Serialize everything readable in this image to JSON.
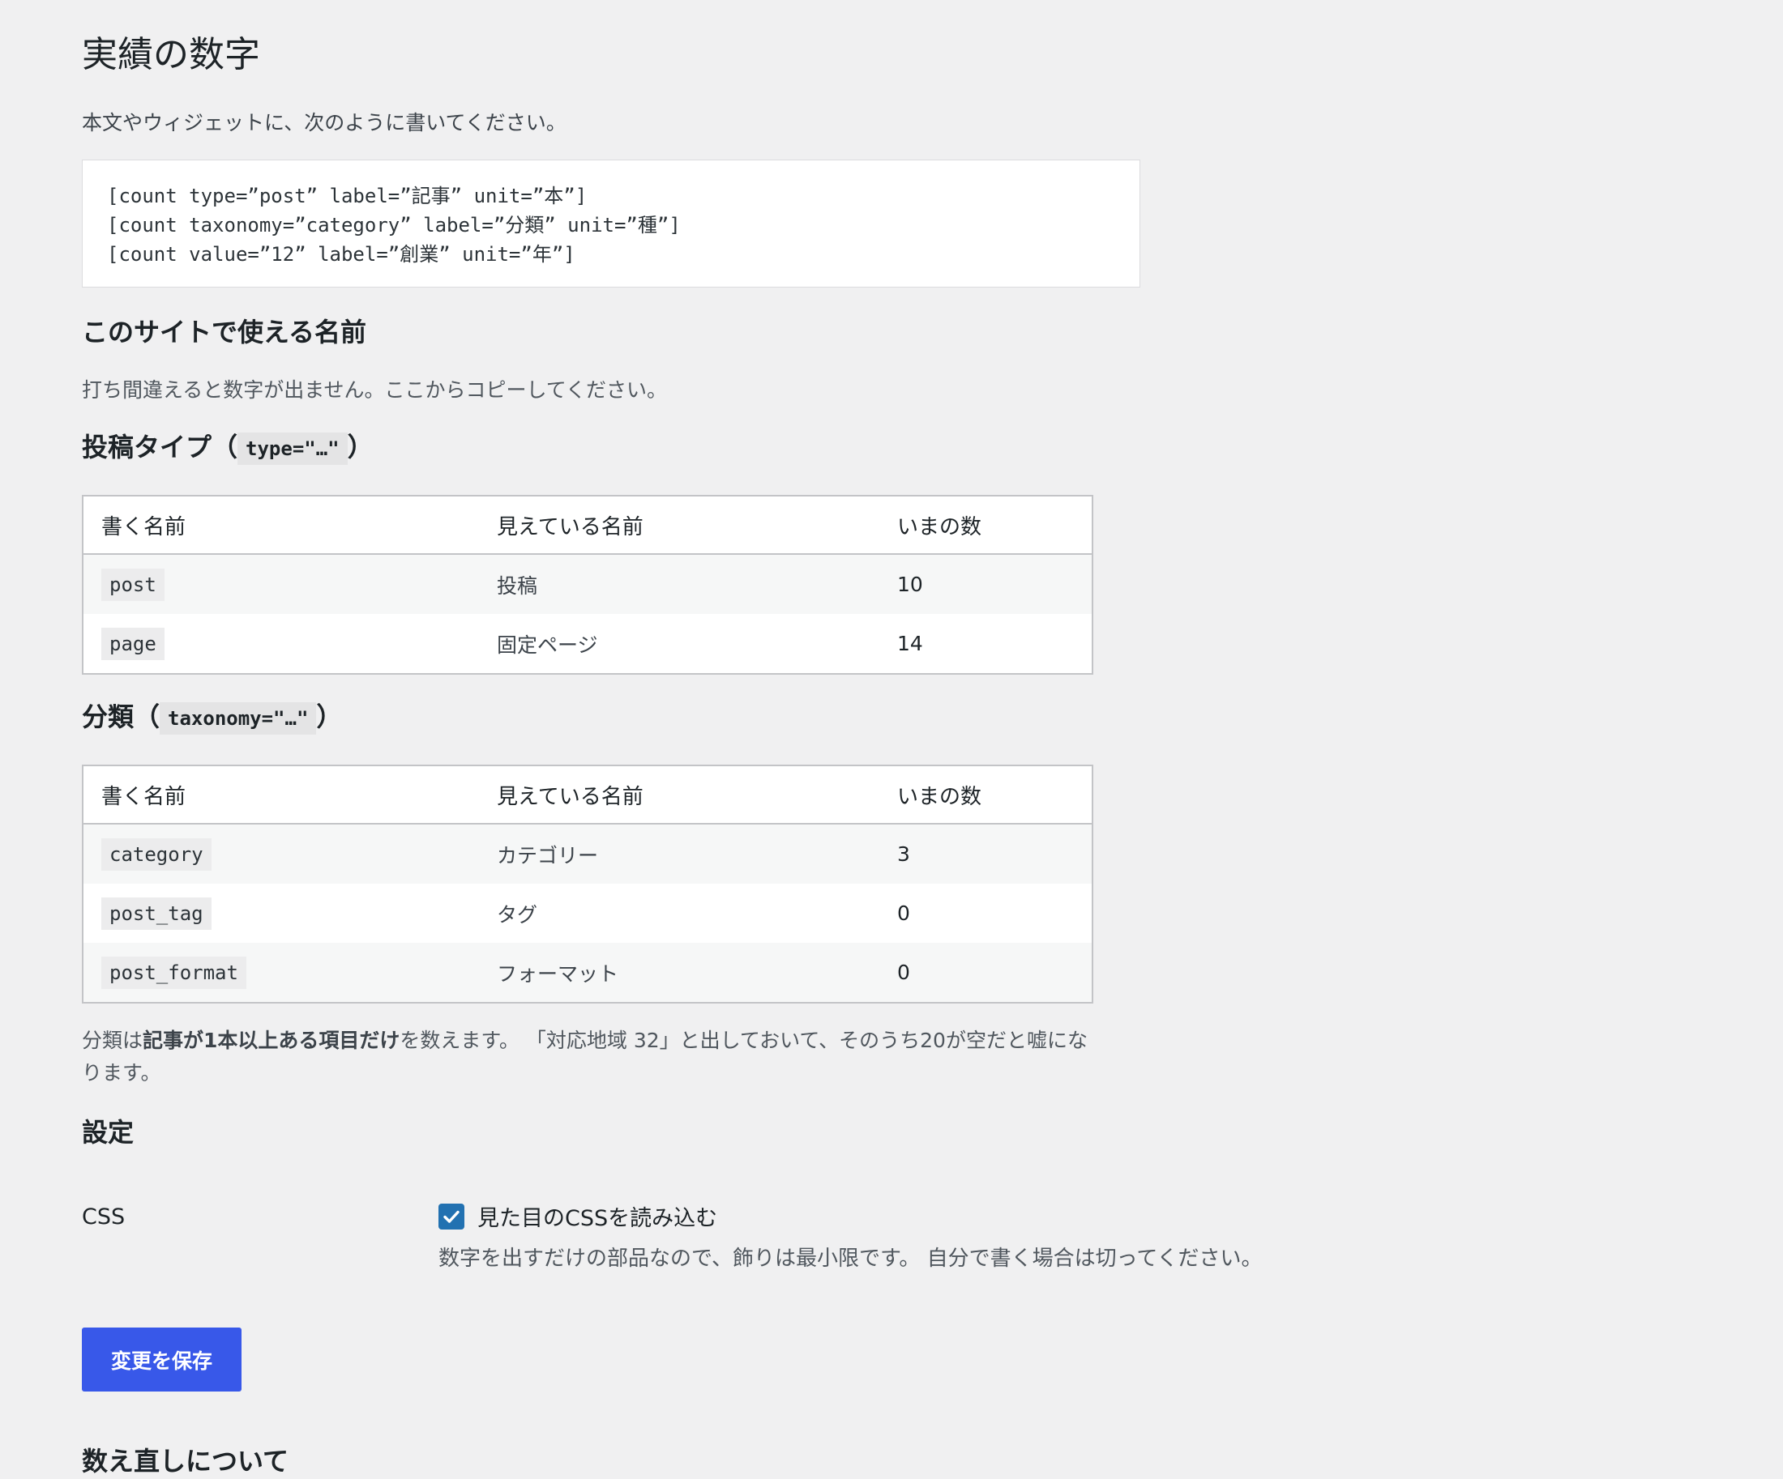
{
  "page": {
    "title": "実績の数字",
    "intro": "本文やウィジェットに、次のように書いてください。"
  },
  "code_examples": [
    "[count type=”post” label=”記事” unit=”本”]",
    "[count taxonomy=”category” label=”分類” unit=”種”]",
    "[count value=”12” label=”創業” unit=”年”]"
  ],
  "names_section": {
    "heading": "このサイトで使える名前",
    "note": "打ち間違えると数字が出ません。ここからコピーしてください。"
  },
  "post_types": {
    "heading_prefix": "投稿タイプ（",
    "heading_code": "type=\"…\"",
    "heading_suffix": "）",
    "columns": [
      "書く名前",
      "見えている名前",
      "いまの数"
    ],
    "rows": [
      {
        "slug": "post",
        "label": "投稿",
        "count": "10"
      },
      {
        "slug": "page",
        "label": "固定ページ",
        "count": "14"
      }
    ]
  },
  "taxonomies": {
    "heading_prefix": "分類（",
    "heading_code": "taxonomy=\"…\"",
    "heading_suffix": "）",
    "columns": [
      "書く名前",
      "見えている名前",
      "いまの数"
    ],
    "rows": [
      {
        "slug": "category",
        "label": "カテゴリー",
        "count": "3"
      },
      {
        "slug": "post_tag",
        "label": "タグ",
        "count": "0"
      },
      {
        "slug": "post_format",
        "label": "フォーマット",
        "count": "0"
      }
    ]
  },
  "footnote": {
    "part1": "分類は",
    "bold": "記事が1本以上ある項目だけ",
    "part2": "を数えます。 「対応地域 32」と出しておいて、そのうち20が空だと嘘になります。"
  },
  "settings": {
    "heading": "設定",
    "css_label": "CSS",
    "css_checkbox_label": "見た目のCSSを読み込む",
    "css_checked": true,
    "css_description": "数字を出すだけの部品なので、飾りは最小限です。 自分で書く場合は切ってください。"
  },
  "save_button_label": "変更を保存",
  "next_heading": "数え直しについて",
  "colors": {
    "background": "#f0f0f1",
    "primary_button": "#3858e9",
    "checkbox": "#2271b1"
  }
}
